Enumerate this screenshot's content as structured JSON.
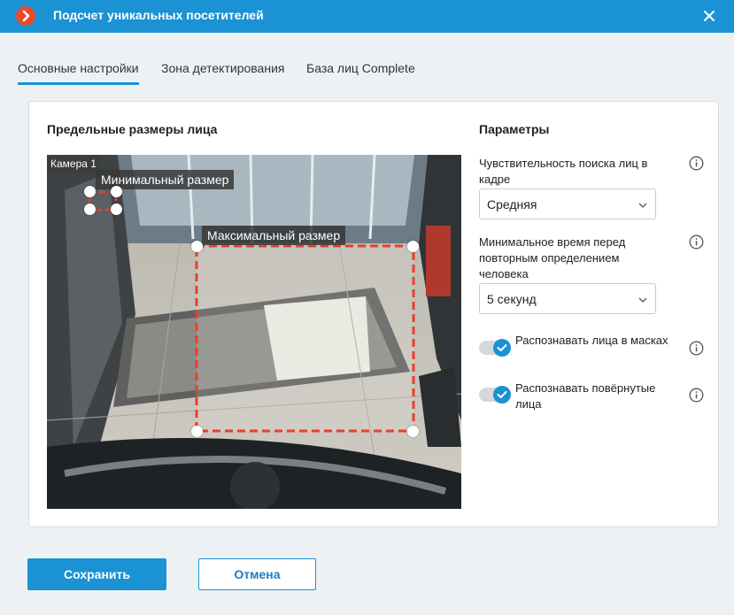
{
  "window": {
    "title": "Подсчет уникальных посетителей",
    "logo_icon": "macroscop-logo-icon",
    "close_icon": "close-icon"
  },
  "tabs": [
    {
      "label": "Основные настройки",
      "active": true
    },
    {
      "label": "Зона детектирования",
      "active": false
    },
    {
      "label": "База лиц Complete",
      "active": false
    }
  ],
  "face_sizes": {
    "title": "Предельные размеры лица",
    "camera_label": "Камера 1",
    "min_label": "Минимальный размер",
    "max_label": "Максимальный размер"
  },
  "params": {
    "title": "Параметры",
    "sensitivity": {
      "label": "Чувствительность поиска лиц в кадре",
      "value": "Средняя"
    },
    "min_time": {
      "label": "Минимальное время перед повторным определением человека",
      "value": "5 секунд"
    },
    "masks": {
      "label": "Распознавать лица в масках",
      "checked": true
    },
    "rotated": {
      "label": "Распознавать повёрнутые лица",
      "checked": true
    }
  },
  "footer": {
    "save_label": "Сохранить",
    "cancel_label": "Отмена"
  },
  "colors": {
    "accent": "#1a92d4",
    "logo": "#e9492a",
    "box_dash": "#e8402a"
  }
}
